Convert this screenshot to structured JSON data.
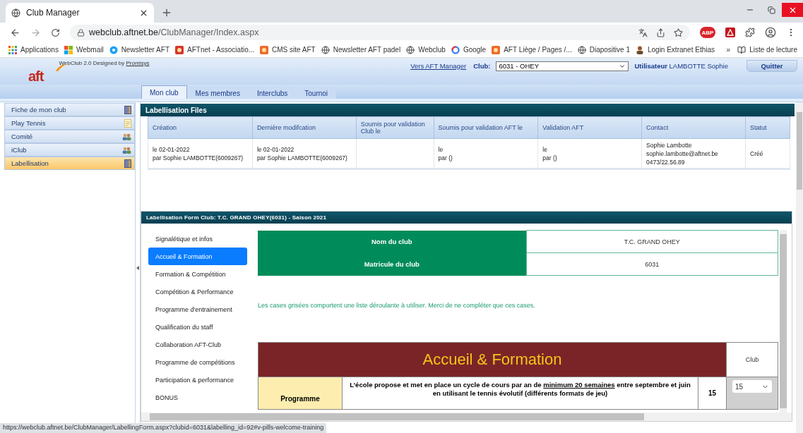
{
  "browser": {
    "tab_title": "Club Manager",
    "address_host": "webclub.aftnet.be",
    "address_path": "/ClubManager/Index.aspx",
    "adblock_label": "ABP",
    "bookmarks": [
      {
        "label": "Applications"
      },
      {
        "label": "Webmail"
      },
      {
        "label": "Newsletter AFT"
      },
      {
        "label": "AFTnet - Associatio..."
      },
      {
        "label": "CMS site AFT"
      },
      {
        "label": "Newsletter AFT padel"
      },
      {
        "label": "Webclub"
      },
      {
        "label": "Google"
      },
      {
        "label": "AFT Liège / Pages /..."
      },
      {
        "label": "Diapositive 1"
      },
      {
        "label": "Login Extranet Ethias"
      }
    ],
    "more": "»",
    "reading_list": "Liste de lecture",
    "status_url": "https://webclub.aftnet.be/ClubManager/LabellingForm.aspx?clubid=6031&labelling_id=92#v-pills-welcome-training"
  },
  "header": {
    "logo": "aft",
    "designed_by": "WebClub 2.0 Designed by",
    "designer": "Promisys",
    "manager_link": "Vers AFT Manager",
    "club_label": "Club:",
    "club_value": "6031 - OHEY",
    "user_label": "Utilisateur",
    "user_name": "LAMBOTTE Sophie",
    "quit": "Quitter"
  },
  "nav_tabs": [
    {
      "label": "Mon club",
      "selected": true
    },
    {
      "label": "Mes membres",
      "selected": false
    },
    {
      "label": "Interclubs",
      "selected": false
    },
    {
      "label": "Tournoi",
      "selected": false
    }
  ],
  "sidebar": {
    "items": [
      {
        "label": "Fiche de mon club",
        "selected": false
      },
      {
        "label": "Play Tennis",
        "selected": false
      },
      {
        "label": "Comité",
        "selected": false
      },
      {
        "label": "iClub",
        "selected": false
      },
      {
        "label": "Labellisation",
        "selected": true
      }
    ]
  },
  "files": {
    "title": "Labellisation Files",
    "columns": [
      "Création",
      "Dernière modifcation",
      "Soumis pour validation Club le",
      "Soumis pour validation AFT le",
      "Validation AFT",
      "Contact",
      "Statut"
    ],
    "rows": [
      {
        "cells": [
          [
            "le 02-01-2022",
            "par Sophie LAMBOTTE(6009267)"
          ],
          [
            "le 02-01-2022",
            "par Sophie LAMBOTTE(6009267)"
          ],
          [],
          [
            "le",
            "par ()"
          ],
          [
            "le",
            "par ()"
          ],
          [
            "Sophie Lambotte",
            "sophie.lambotte@aftnet.be",
            "0473/22.56.89"
          ],
          [
            "Créé"
          ]
        ]
      }
    ]
  },
  "form": {
    "title": "Labellisation Form Club: T.C. GRAND OHEY(6031) - Saison 2021",
    "pills": [
      {
        "label": "Signalétique et infos",
        "selected": false
      },
      {
        "label": "Accueil & Formation",
        "selected": true
      },
      {
        "label": "Formation & Compétition",
        "selected": false
      },
      {
        "label": "Compétition & Performance",
        "selected": false
      },
      {
        "label": "Programme d'entrainement",
        "selected": false
      },
      {
        "label": "Qualification du staff",
        "selected": false
      },
      {
        "label": "Collaboration AFT-Club",
        "selected": false
      },
      {
        "label": "Programme de compétitions",
        "selected": false
      },
      {
        "label": "Participation & performance",
        "selected": false
      },
      {
        "label": "BONUS",
        "selected": false
      }
    ],
    "club_info": [
      {
        "label": "Nom du club",
        "value": "T.C. GRAND OHEY"
      },
      {
        "label": "Matricule du club",
        "value": "6031"
      }
    ],
    "notice": "Les cases grisées comportent une liste déroulante à utiliser. Merci de ne compléter que ces cases.",
    "section": {
      "title": "Accueil & Formation",
      "club_header": "Club",
      "rows": [
        {
          "category": "Programme",
          "segments": [
            {
              "text": "L’école propose et met en place un cycle de cours par an de ",
              "underlined": false
            },
            {
              "text": "minimum 20 semaines",
              "underlined": true
            },
            {
              "text": " entre septembre et juin en utilisant le tennis évolutif (différents formats de jeu)",
              "underlined": false
            }
          ],
          "points": "15",
          "choice": "15"
        }
      ]
    }
  }
}
